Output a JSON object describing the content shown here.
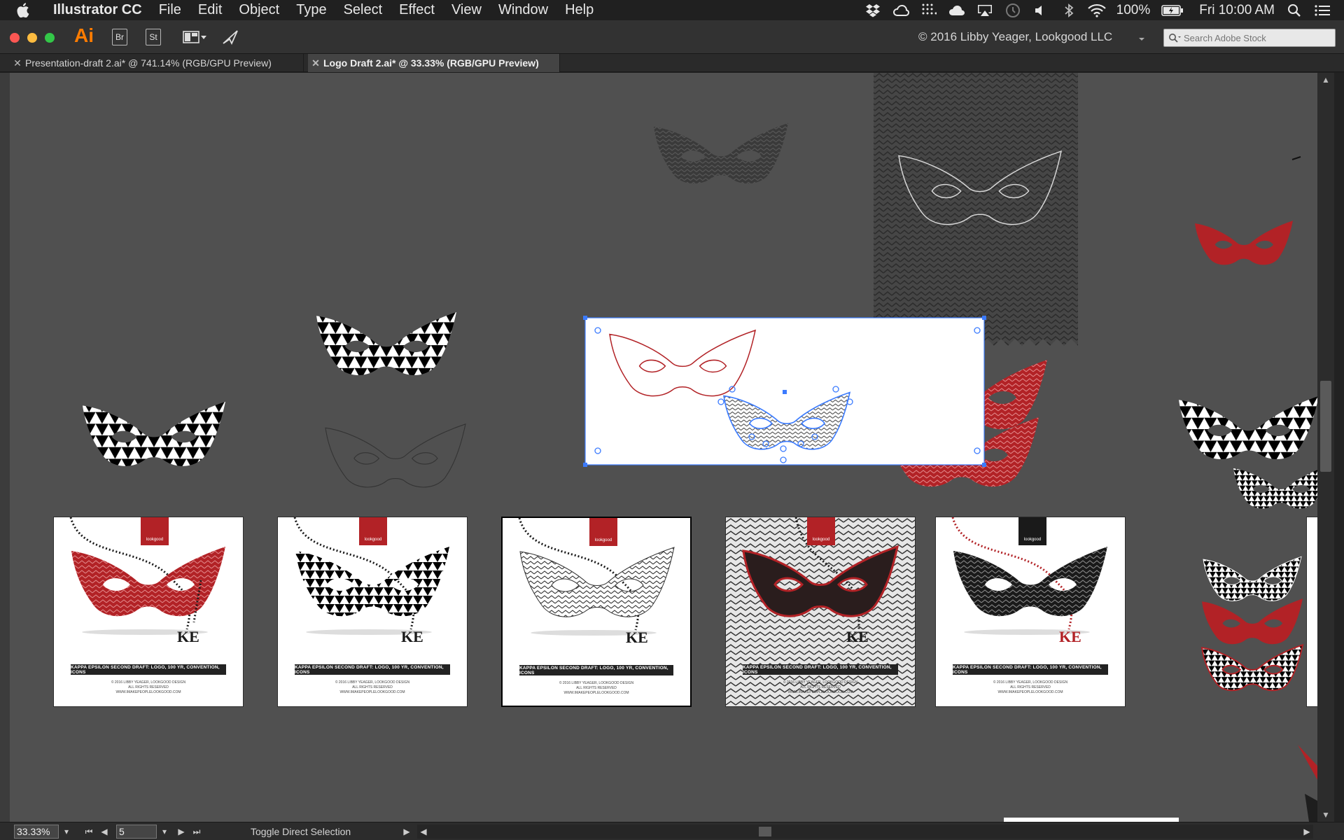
{
  "menubar": {
    "app_name": "Illustrator CC",
    "items": [
      "File",
      "Edit",
      "Object",
      "Type",
      "Select",
      "Effect",
      "View",
      "Window",
      "Help"
    ],
    "battery": "100%",
    "clock": "Fri 10:00 AM"
  },
  "appbar": {
    "app_icon": "Ai",
    "bridge_label": "Br",
    "stock_label": "St",
    "workspace_owner": "© 2016 Libby Yeager, Lookgood LLC",
    "search_placeholder": "Search Adobe Stock"
  },
  "tabs": [
    {
      "label": "Presentation-draft 2.ai* @ 741.14% (RGB/GPU Preview)",
      "active": false
    },
    {
      "label": "Logo Draft 2.ai* @ 33.33% (RGB/GPU Preview)",
      "active": true
    }
  ],
  "artboards": [
    {
      "badge": "lookgood",
      "banner": "KAPPA EPSILON SECOND DRAFT: LOGO, 100 YR, CONVENTION, ICONS",
      "fine": [
        "© 2016 LIBBY YEAGER, LOOKGOOD DESIGN",
        "ALL RIGHTS RESERVED",
        "WWW.IMAKEPEOPLELOOKGOOD.COM"
      ],
      "monogram": "KE"
    },
    {
      "badge": "lookgood",
      "banner": "KAPPA EPSILON SECOND DRAFT: LOGO, 100 YR, CONVENTION, ICONS",
      "fine": [
        "© 2016 LIBBY YEAGER, LOOKGOOD DESIGN",
        "ALL RIGHTS RESERVED",
        "WWW.IMAKEPEOPLELOOKGOOD.COM"
      ],
      "monogram": "KE"
    },
    {
      "badge": "lookgood",
      "banner": "KAPPA EPSILON SECOND DRAFT: LOGO, 100 YR, CONVENTION, ICONS",
      "fine": [
        "© 2016 LIBBY YEAGER, LOOKGOOD DESIGN",
        "ALL RIGHTS RESERVED",
        "WWW.IMAKEPEOPLELOOKGOOD.COM"
      ],
      "monogram": "KE"
    },
    {
      "badge": "lookgood",
      "banner": "KAPPA EPSILON SECOND DRAFT: LOGO, 100 YR, CONVENTION, ICONS",
      "fine": [
        "© 2016 LIBBY YEAGER, LOOKGOOD DESIGN",
        "ALL RIGHTS RESERVED",
        "WWW.IMAKEPEOPLELOOKGOOD.COM"
      ],
      "monogram": "KE"
    },
    {
      "badge": "lookgood",
      "banner": "KAPPA EPSILON SECOND DRAFT: LOGO, 100 YR, CONVENTION, ICONS",
      "fine": [
        "© 2016 LIBBY YEAGER, LOOKGOOD DESIGN",
        "ALL RIGHTS RESERVED",
        "WWW.IMAKEPEOPLELOOKGOOD.COM"
      ],
      "monogram": "KE"
    }
  ],
  "statusbar": {
    "zoom": "33.33%",
    "artboard_number": "5",
    "tool_hint": "Toggle Direct Selection"
  },
  "colors": {
    "canvas": "#505050",
    "accent_red": "#b22226",
    "selection_blue": "#3b7bff",
    "ai_orange": "#ff7c00"
  }
}
